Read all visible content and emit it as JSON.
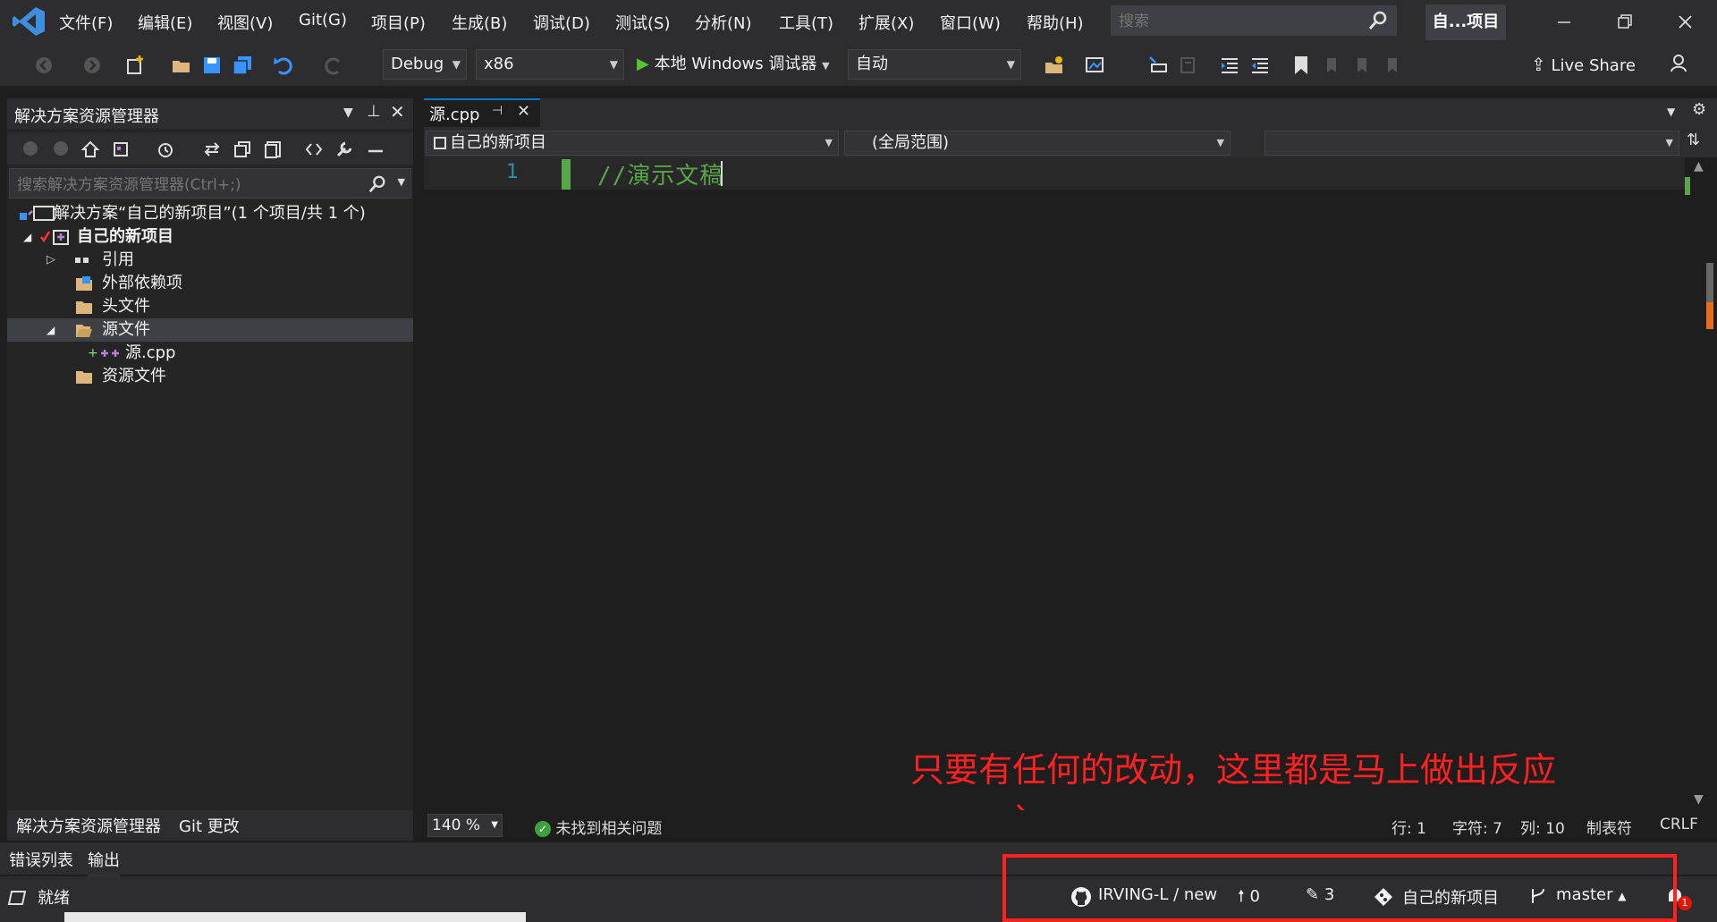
{
  "menu": [
    "文件(F)",
    "编辑(E)",
    "视图(V)",
    "Git(G)",
    "项目(P)",
    "生成(B)",
    "调试(D)",
    "测试(S)",
    "分析(N)",
    "工具(T)",
    "扩展(X)",
    "窗口(W)",
    "帮助(H)"
  ],
  "search": {
    "placeholder": "搜索"
  },
  "project_badge": "自...项目",
  "toolbar": {
    "config": "Debug",
    "platform": "x86",
    "run_label": "本地 Windows 调试器",
    "auto": "自动",
    "live_share": "Live Share"
  },
  "solution_explorer": {
    "title": "解决方案资源管理器",
    "search_placeholder": "搜索解决方案资源管理器(Ctrl+;)",
    "tree": [
      {
        "label": "解决方案“自己的新项目”(1 个项目/共 1 个)"
      },
      {
        "label": "自己的新项目"
      },
      {
        "label": "引用"
      },
      {
        "label": "外部依赖项"
      },
      {
        "label": "头文件"
      },
      {
        "label": "源文件"
      },
      {
        "label": "源.cpp"
      },
      {
        "label": "资源文件"
      }
    ],
    "bottom_tabs": [
      "解决方案资源管理器",
      "Git 更改"
    ]
  },
  "editor": {
    "tab_label": "源.cpp",
    "nav_project": "自己的新项目",
    "nav_scope": "(全局范围)",
    "line_number": "1",
    "code_line": "//演示文稿",
    "annotation": "只要有任何的改动，这里都是马上做出反应",
    "zoom": "140 %",
    "issues": "未找到相关问题",
    "line": "行: 1",
    "char": "字符: 7",
    "col": "列: 10",
    "tabs": "制表符",
    "eol": "CRLF"
  },
  "output_tabs": [
    "错误列表",
    "输出"
  ],
  "status": {
    "ready": "就绪",
    "repo": "IRVING-L / new",
    "push": "0",
    "changes": "3",
    "project": "自己的新项目",
    "branch": "master",
    "notifications": "1"
  },
  "colors": {
    "accent": "#007acc",
    "comment": "#57a64a",
    "annotation_red": "#ff2020"
  }
}
